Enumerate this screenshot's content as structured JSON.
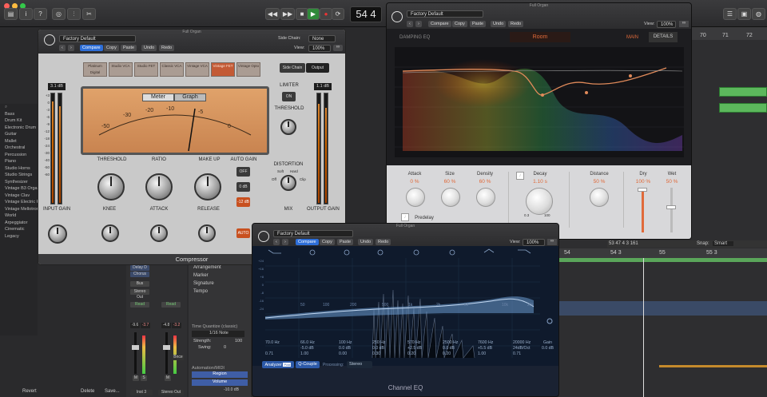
{
  "toolbar": {
    "lcd_value": "54 4",
    "transport": [
      "rewind",
      "fast-forward",
      "stop",
      "play",
      "record",
      "cycle"
    ]
  },
  "tracks": {
    "ruler_top": [
      "70",
      "71",
      "72"
    ],
    "ruler_bottom": [
      "54",
      "54 3",
      "55",
      "55 3"
    ],
    "edit_position": "53   47 4 3 161",
    "snap_label": "Snap:",
    "snap_value": "Smart"
  },
  "library": {
    "items": [
      "Bass",
      "Drum Kit",
      "Electronic Drum K",
      "Guitar",
      "Mallet",
      "Orchestral",
      "Percussion",
      "Piano",
      "Studio Horns",
      "Studio Strings",
      "Synthesizer",
      "Vintage B3 Organ",
      "Vintage Clav",
      "Vintage Electric P",
      "Vintage Mellotron",
      "World",
      "Arpeggiator",
      "Cinematic",
      "Legacy"
    ]
  },
  "compressor": {
    "window_title": "Full Organ",
    "preset": "Factory Default",
    "header_buttons": [
      "Compare",
      "Copy",
      "Paste",
      "Undo",
      "Redo"
    ],
    "side_chain_label": "Side Chain:",
    "side_chain_value": "None",
    "view_label": "View:",
    "view_value": "100%",
    "types": [
      "Platinum Digital",
      "Studio VCA",
      "Studio FET",
      "Classic VCA",
      "Vintage VCA",
      "Vintage FET",
      "Vintage Opto"
    ],
    "selected_type": "Vintage FET",
    "side_chain_btn": "Side Chain",
    "output_btn": "Output",
    "input_meter_value": "3.1 dB",
    "output_meter_value": "1.1 dB",
    "meter_tab": "Meter",
    "graph_tab": "Graph",
    "meter_scale": [
      "-50",
      "-30",
      "-20",
      "-10",
      "-5",
      "0"
    ],
    "labels": {
      "threshold": "THRESHOLD",
      "ratio": "RATIO",
      "makeup": "MAKE UP",
      "auto_gain": "AUTO GAIN",
      "knee": "KNEE",
      "attack": "ATTACK",
      "release": "RELEASE",
      "input_gain": "INPUT GAIN",
      "limiter": "LIMITER",
      "limiter_threshold": "THRESHOLD",
      "distortion": "DISTORTION",
      "mix": "MIX",
      "output_gain": "OUTPUT GAIN"
    },
    "auto_gain_options": [
      "OFF",
      "0 dB",
      "-12 dB"
    ],
    "auto_btn": "AUTO",
    "limiter_btn": "ON",
    "distortion_options": [
      "Soft",
      "Hard"
    ],
    "distortion_off": "Off",
    "distortion_clip": "Clip",
    "meter_scale_left": [
      "+3",
      "0",
      "-3",
      "-6",
      "-9",
      "-12",
      "-18",
      "-24",
      "-30",
      "-40",
      "-50",
      "-60"
    ],
    "footer": "Compressor"
  },
  "reverb": {
    "window_title": "Full Organ",
    "preset": "Factory Default",
    "header_buttons": [
      "Compare",
      "Copy",
      "Paste",
      "Undo",
      "Redo"
    ],
    "view_label": "View:",
    "view_value": "100%",
    "damping_eq": "DAMPING EQ",
    "room": "Room",
    "main_tab": "MAIN",
    "details_tab": "DETAILS",
    "controls": [
      {
        "label": "Attack",
        "value": "0 %"
      },
      {
        "label": "Size",
        "value": "60 %"
      },
      {
        "label": "Density",
        "value": "60 %"
      },
      {
        "label": "Decay",
        "value": "1.10 s"
      },
      {
        "label": "Distance",
        "value": "50 %"
      },
      {
        "label": "Dry",
        "value": "100 %"
      },
      {
        "label": "Wet",
        "value": "50 %"
      }
    ],
    "predelay_label": "Predelay",
    "decay_min": "0.3",
    "decay_max": "100"
  },
  "eq": {
    "window_title": "Full Organ",
    "preset": "Factory Default",
    "header_buttons": [
      "Compare",
      "Copy",
      "Paste",
      "Undo",
      "Redo"
    ],
    "view_label": "View:",
    "view_value": "100%",
    "freq_axis": [
      "50",
      "100",
      "200",
      "500",
      "1k",
      "2k",
      "5k",
      "10k",
      "20k"
    ],
    "db_axis": [
      "+24",
      "+20",
      "+16",
      "+12",
      "+8",
      "+4",
      "0",
      "-4",
      "-8",
      "-12",
      "-16",
      "-20",
      "-24"
    ],
    "bands": [
      {
        "freq": "70.0 Hz",
        "gain": "",
        "q": "0.71"
      },
      {
        "freq": "66.0 Hz",
        "gain": "-5.0 dB",
        "q": "1.00"
      },
      {
        "freq": "100 Hz",
        "gain": "0.0 dB",
        "q": "0.00"
      },
      {
        "freq": "250 Hz",
        "gain": "0.0 dB",
        "q": "0.30"
      },
      {
        "freq": "570 Hz",
        "gain": "+2.5 dB",
        "q": "0.20"
      },
      {
        "freq": "2500 Hz",
        "gain": "0.0 dB",
        "q": "0.20"
      },
      {
        "freq": "7600 Hz",
        "gain": "+5.5 dB",
        "q": "1.00"
      },
      {
        "freq": "20000 Hz",
        "gain": "24dB/Oct",
        "q": "0.71"
      }
    ],
    "gain_label": "Gain",
    "gain_value": "0.0 dB",
    "analyzer_btn": "Analyzer",
    "analyzer_sub": "Post",
    "qcouple_btn": "Q-Couple",
    "processing_label": "Processing:",
    "processing_value": "Stereo",
    "footer": "Channel EQ"
  },
  "mixer": {
    "slot_a": "Delay D",
    "slot_b": "Chorus",
    "bus": "Bus",
    "out_a": "Stereo Out",
    "read_a": "Read",
    "read_b": "Read",
    "vol_a": "-9.6",
    "vol_b": "-3.7",
    "vol_c": "-4.8",
    "vol_d": "-3.2",
    "m": "M",
    "s": "S",
    "name_a": "Inst 3",
    "name_b": "Stereo Out",
    "bnce": "Bnce"
  },
  "inspector": {
    "items": [
      "Arrangement",
      "Marker",
      "Signature",
      "Tempo"
    ],
    "time_quantize": "Time Quantize (classic)",
    "quant_value": "1/16 Note",
    "strength_label": "Strength:",
    "strength_value": "100",
    "swing_label": "Swing:",
    "swing_value": "0",
    "automation": "Automation/MIDI",
    "region": "Region",
    "volume": "Volume",
    "volume_value": "-10.0 dB"
  },
  "bottom_left": {
    "revert": "Revert",
    "delete": "Delete",
    "save": "Save..."
  },
  "colors": {
    "orange": "#e06a3a",
    "blue": "#2d6ed8",
    "green": "#4caf50",
    "vintage_orange": "#c35a35"
  }
}
